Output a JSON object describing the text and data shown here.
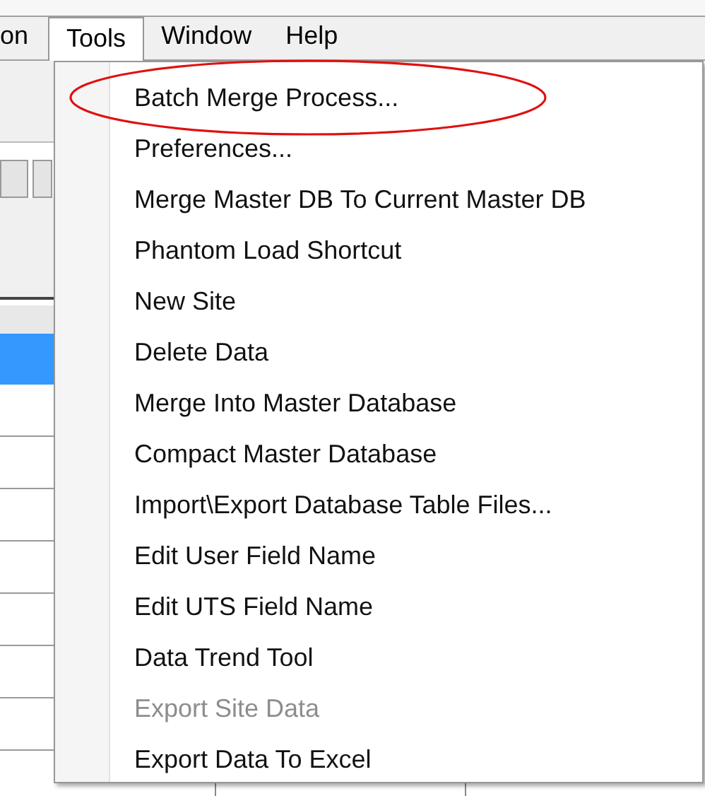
{
  "menu_bar": [
    {
      "label": "on",
      "selected": false
    },
    {
      "label": "Tools",
      "selected": true
    },
    {
      "label": "Window",
      "selected": false
    },
    {
      "label": "Help",
      "selected": false
    }
  ],
  "menu": {
    "items": [
      {
        "label": "Batch Merge Process...",
        "disabled": false,
        "circled": true
      },
      {
        "label": "Preferences...",
        "disabled": false,
        "circled": false
      },
      {
        "label": "Merge Master DB To Current Master DB",
        "disabled": false,
        "circled": false
      },
      {
        "label": "Phantom Load Shortcut",
        "disabled": false,
        "circled": false
      },
      {
        "label": "New Site",
        "disabled": false,
        "circled": false
      },
      {
        "label": "Delete Data",
        "disabled": false,
        "circled": false
      },
      {
        "label": "Merge Into Master Database",
        "disabled": false,
        "circled": false
      },
      {
        "label": "Compact Master Database",
        "disabled": false,
        "circled": false
      },
      {
        "label": "Import\\Export Database Table Files...",
        "disabled": false,
        "circled": false
      },
      {
        "label": "Edit User Field Name",
        "disabled": false,
        "circled": false
      },
      {
        "label": "Edit UTS Field Name",
        "disabled": false,
        "circled": false
      },
      {
        "label": "Data Trend Tool",
        "disabled": false,
        "circled": false
      },
      {
        "label": "Export Site Data",
        "disabled": true,
        "circled": false
      },
      {
        "label": "Export Data To Excel",
        "disabled": false,
        "circled": false
      }
    ]
  },
  "table": {
    "rows": [
      {
        "selected": true
      },
      {
        "selected": false
      },
      {
        "selected": false
      },
      {
        "selected": false
      },
      {
        "selected": false
      },
      {
        "selected": false
      },
      {
        "selected": false
      },
      {
        "selected": false
      }
    ]
  }
}
